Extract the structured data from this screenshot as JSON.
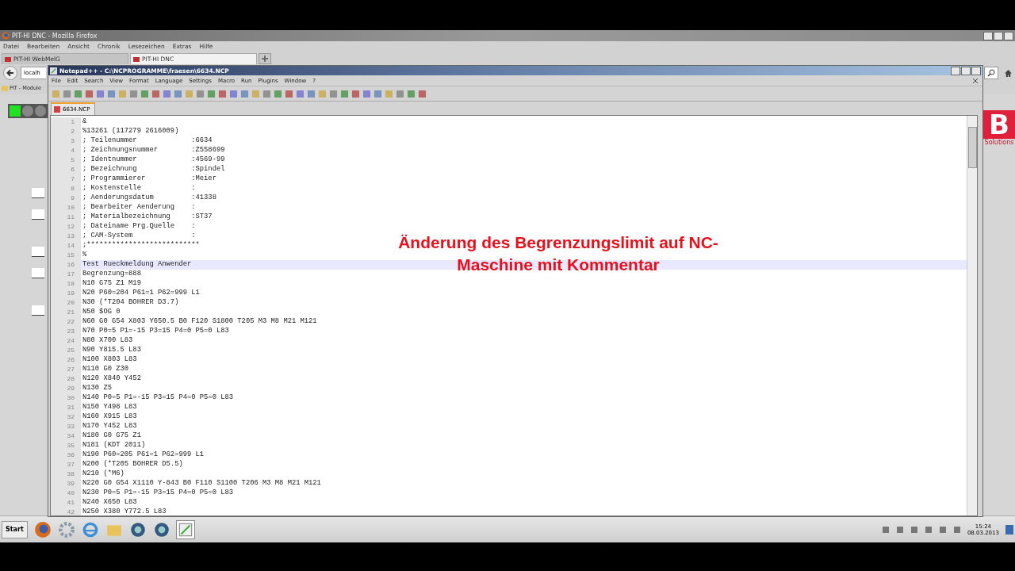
{
  "browser": {
    "title": "PIT-HI DNC - Mozilla Firefox",
    "menu": [
      "Datei",
      "Bearbeiten",
      "Ansicht",
      "Chronik",
      "Lesezeichen",
      "Extras",
      "Hilfe"
    ],
    "tabs": [
      {
        "label": "PIT-HI WebMelG",
        "selected": false
      },
      {
        "label": "PIT-HI DNC",
        "selected": true
      }
    ],
    "address": "localh",
    "bookmark": "PIT - Module",
    "lamps": [
      {
        "on": true
      },
      {
        "on": false
      },
      {
        "on": false
      }
    ],
    "logo_letter": "B",
    "logo_text": "Solutions"
  },
  "editor": {
    "title": "Notepad++ - C:\\NCPROGRAMME\\fraesen\\6634.NCP",
    "menu": [
      "File",
      "Edit",
      "Search",
      "View",
      "Format",
      "Language",
      "Settings",
      "Macro",
      "Run",
      "Plugins",
      "Window",
      "?"
    ],
    "tabs": [
      {
        "label": "6634.NCP",
        "selected": true
      }
    ],
    "lines": [
      {
        "number": "1",
        "text": "&",
        "current": false
      },
      {
        "number": "2",
        "text": "%13261 (117279 2616009)",
        "current": false
      },
      {
        "number": "3",
        "text": "; Teilenummer             :6634",
        "current": false
      },
      {
        "number": "4",
        "text": "; Zeichnungsnummer        :Z558699",
        "current": false
      },
      {
        "number": "5",
        "text": "; Identnummer             :4569-99",
        "current": false
      },
      {
        "number": "6",
        "text": "; Bezeichnung             :Spindel",
        "current": false
      },
      {
        "number": "7",
        "text": "; Programmierer           :Meier",
        "current": false
      },
      {
        "number": "8",
        "text": "; Kostenstelle            :",
        "current": false
      },
      {
        "number": "9",
        "text": "; Aenderungsdatum         :41338",
        "current": false
      },
      {
        "number": "10",
        "text": "; Bearbeiter Aenderung    :",
        "current": false
      },
      {
        "number": "11",
        "text": "; Materialbezeichnung     :ST37",
        "current": false
      },
      {
        "number": "12",
        "text": "; Dateiname Prg.Quelle    :",
        "current": false
      },
      {
        "number": "13",
        "text": "; CAM-System              :",
        "current": false
      },
      {
        "number": "14",
        "text": ";***************************",
        "current": false
      },
      {
        "number": "15",
        "text": "%",
        "current": false
      },
      {
        "number": "16",
        "text": "Test Rueckmeldung Anwender",
        "current": true
      },
      {
        "number": "17",
        "text": "Begrenzung=888",
        "current": false
      },
      {
        "number": "18",
        "text": "N10 G75 Z1 M19",
        "current": false
      },
      {
        "number": "19",
        "text": "N20 P60=204 P61=1 P62=999 L1",
        "current": false
      },
      {
        "number": "20",
        "text": "N30 (*T204 BOHRER D3.7)",
        "current": false
      },
      {
        "number": "21",
        "text": "N50 $OG 0",
        "current": false
      },
      {
        "number": "22",
        "text": "N60 G0 G54 X803 Y650.5 B0 F120 S1800 T205 M3 M8 M21 M121",
        "current": false
      },
      {
        "number": "23",
        "text": "N70 P0=5 P1=-15 P3=15 P4=0 P5=0 L83",
        "current": false
      },
      {
        "number": "24",
        "text": "N80 X700 L83",
        "current": false
      },
      {
        "number": "25",
        "text": "N90 Y815.5 L83",
        "current": false
      },
      {
        "number": "26",
        "text": "N100 X803 L83",
        "current": false
      },
      {
        "number": "27",
        "text": "N110 G0 Z30",
        "current": false
      },
      {
        "number": "28",
        "text": "N120 X840 Y452",
        "current": false
      },
      {
        "number": "29",
        "text": "N130 Z5",
        "current": false
      },
      {
        "number": "30",
        "text": "N140 P0=5 P1=-15 P3=15 P4=0 P5=0 L83",
        "current": false
      },
      {
        "number": "31",
        "text": "N150 Y498 L83",
        "current": false
      },
      {
        "number": "32",
        "text": "N160 X915 L83",
        "current": false
      },
      {
        "number": "33",
        "text": "N170 Y452 L83",
        "current": false
      },
      {
        "number": "34",
        "text": "N180 G0 G75 Z1",
        "current": false
      },
      {
        "number": "35",
        "text": "N181 (KDT 2011)",
        "current": false
      },
      {
        "number": "36",
        "text": "N190 P60=205 P61=1 P62=999 L1",
        "current": false
      },
      {
        "number": "37",
        "text": "N200 (*T205 BOHRER D5.5)",
        "current": false
      },
      {
        "number": "38",
        "text": "N210 (*M6)",
        "current": false
      },
      {
        "number": "39",
        "text": "N220 G0 G54 X1110 Y-843 B0 F110 S1100 T206 M3 M8 M21 M121",
        "current": false
      },
      {
        "number": "40",
        "text": "N230 P0=5 P1=-15 P3=15 P4=0 P5=0 L83",
        "current": false
      },
      {
        "number": "41",
        "text": "N240 X650 L83",
        "current": false
      },
      {
        "number": "42",
        "text": "N250 X380 Y772.5 L83",
        "current": false
      }
    ]
  },
  "caption": [
    "Änderung des Begrenzungslimit auf NC-",
    "Maschine mit Kommentar"
  ],
  "taskbar": {
    "start": "Start",
    "time": "15:24",
    "date": "08.03.2013"
  }
}
